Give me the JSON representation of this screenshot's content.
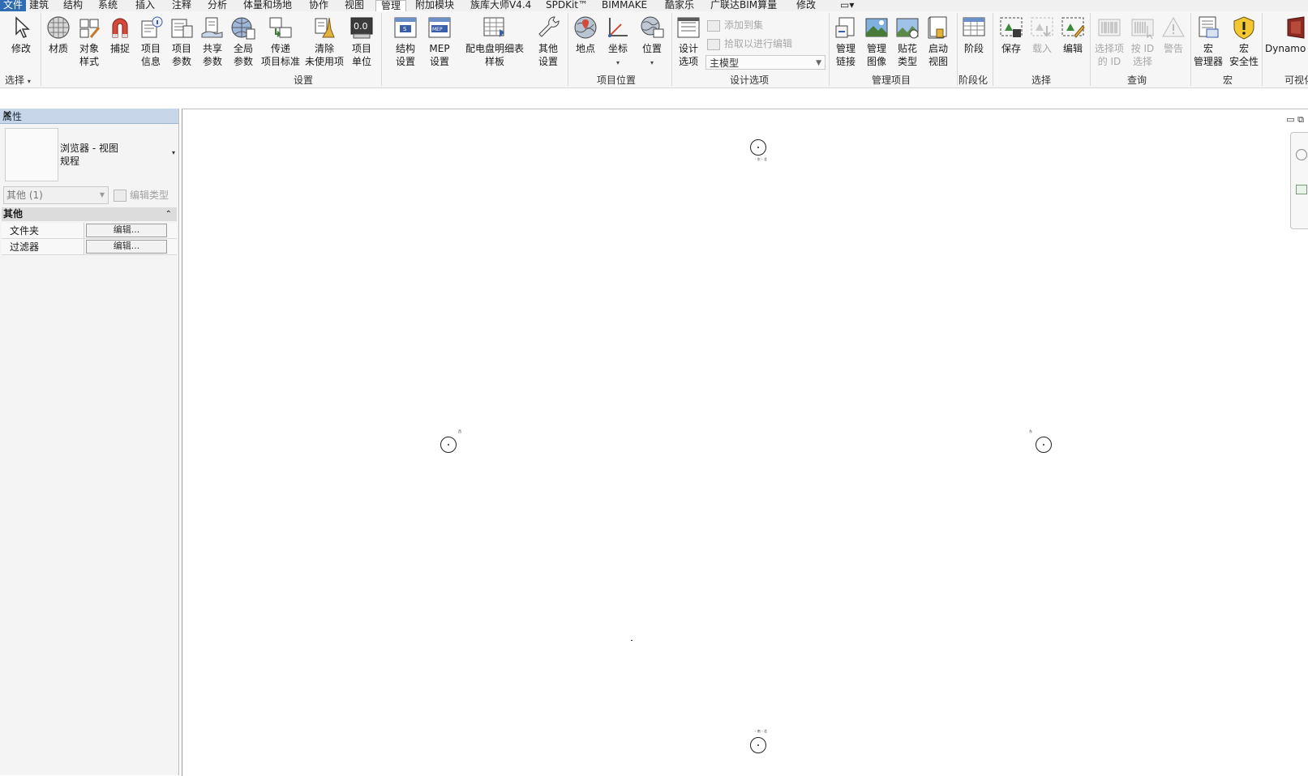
{
  "menu": {
    "file": "文件",
    "tabs": [
      "建筑",
      "结构",
      "系统",
      "插入",
      "注释",
      "分析",
      "体量和场地",
      "协作",
      "视图",
      "管理",
      "附加模块",
      "族库大师V4.4",
      "SPDKit™",
      "BIMMAKE",
      "酷家乐",
      "广联达BIM算量",
      "修改"
    ],
    "active_tab": "管理",
    "extra_glyph": "▭▾"
  },
  "ribbon": {
    "select_panel": {
      "modify": "修改",
      "label": "选择",
      "caret": "▾"
    },
    "settings_panel": {
      "label": "设置",
      "buttons": [
        {
          "line1": "材质",
          "line2": ""
        },
        {
          "line1": "对象",
          "line2": "样式"
        },
        {
          "line1": "捕捉",
          "line2": ""
        },
        {
          "line1": "项目",
          "line2": "信息"
        },
        {
          "line1": "项目",
          "line2": "参数"
        },
        {
          "line1": "共享",
          "line2": "参数"
        },
        {
          "line1": "全局",
          "line2": "参数"
        },
        {
          "line1": "传递",
          "line2": "项目标准"
        },
        {
          "line1": "清除",
          "line2": "未使用项"
        },
        {
          "line1": "项目",
          "line2": "单位"
        },
        {
          "line1": "结构",
          "line2": "设置"
        },
        {
          "line1": "MEP",
          "line2": "设置"
        },
        {
          "line1": "配电盘明细表",
          "line2": "样板"
        },
        {
          "line1": "其他",
          "line2": "设置"
        }
      ]
    },
    "location_panel": {
      "label": "项目位置",
      "buttons": [
        {
          "line1": "地点",
          "line2": ""
        },
        {
          "line1": "坐标",
          "line2": ""
        },
        {
          "line1": "位置",
          "line2": ""
        }
      ]
    },
    "design_options_panel": {
      "label": "设计选项",
      "button": {
        "line1": "设计",
        "line2": "选项"
      },
      "add_to_set": "添加到集",
      "pick_to_edit": "拾取以进行编辑",
      "main_model": "主模型"
    },
    "manage_project_panel": {
      "label": "管理项目",
      "buttons": [
        {
          "line1": "管理",
          "line2": "链接"
        },
        {
          "line1": "管理",
          "line2": "图像"
        },
        {
          "line1": "贴花",
          "line2": "类型"
        },
        {
          "line1": "启动",
          "line2": "视图"
        }
      ]
    },
    "phasing_panel": {
      "label": "阶段化",
      "button": "阶段"
    },
    "selection_panel": {
      "label": "选择",
      "buttons": [
        {
          "line1": "保存",
          "dim": false
        },
        {
          "line1": "载入",
          "dim": true
        },
        {
          "line1": "编辑",
          "dim": false
        }
      ]
    },
    "inquiry_panel": {
      "label": "查询",
      "buttons": [
        {
          "line1": "选择项",
          "line2": "的 ID"
        },
        {
          "line1": "按 ID",
          "line2": "选择"
        },
        {
          "line1": "警告",
          "line2": ""
        }
      ]
    },
    "macros_panel": {
      "label": "宏",
      "buttons": [
        {
          "line1": "宏",
          "line2": "管理器"
        },
        {
          "line1": "宏",
          "line2": "安全性"
        }
      ]
    },
    "dynamo": {
      "label": "Dynamo",
      "panel": "可视化"
    }
  },
  "properties": {
    "title": "属性",
    "close": "✕",
    "type_line1": "浏览器 - 视图",
    "type_line2": "规程",
    "type_caret": "▾",
    "instance_filter": "其他 (1)",
    "edit_type": "编辑类型",
    "group": "其他",
    "group_collapse": "⌃",
    "rows": [
      {
        "name": "文件夹",
        "button": "编辑..."
      },
      {
        "name": "过滤器",
        "button": "编辑..."
      }
    ]
  },
  "canvas": {
    "view_controls": "▭ ⧉",
    "markers": [
      {
        "id": "north",
        "tag": "- 东 - 北"
      },
      {
        "id": "west",
        "tag": "西"
      },
      {
        "id": "east",
        "tag": "东"
      },
      {
        "id": "south",
        "tag": "- 南 - 北"
      }
    ]
  }
}
